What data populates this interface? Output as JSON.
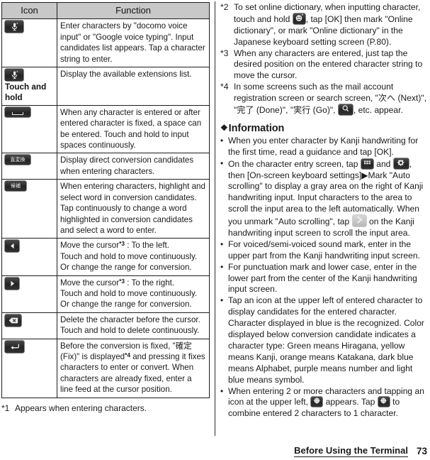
{
  "table": {
    "headers": [
      "Icon",
      "Function"
    ],
    "rows": [
      {
        "icon": "microphone-icon",
        "icon_label": "",
        "function": "Enter characters by \"docomo voice input\" or \"Google voice typing\". Input candidates list appears. Tap a character string to enter."
      },
      {
        "icon": "microphone-icon",
        "icon_label": "Touch and hold",
        "function": "Display the available extensions list."
      },
      {
        "icon": "space-key-icon",
        "icon_label": "",
        "function": "When any character is entered or after entered character is fixed, a space can be entered. Touch and hold to input spaces continuously."
      },
      {
        "icon": "direct-conversion-key-icon",
        "icon_glyph": "直変換",
        "icon_label": "",
        "function": "Display direct conversion candidates when entering characters."
      },
      {
        "icon": "candidates-key-icon",
        "icon_glyph": "候補",
        "icon_label": "",
        "function": "When entering characters, highlight and select word in conversion candidates. Tap continuously to change a word highlighted in conversion candidates and select a word to enter."
      },
      {
        "icon": "arrow-left-key-icon",
        "icon_label": "",
        "function_pre": "Move the cursor",
        "function_ref": "*3",
        "function_post": " : To the left.",
        "function_lines": [
          "Touch and hold to move continuously.",
          "Or change the range for conversion."
        ]
      },
      {
        "icon": "arrow-right-key-icon",
        "icon_label": "",
        "function_pre": "Move the cursor",
        "function_ref": "*3",
        "function_post": " : To the right.",
        "function_lines": [
          "Touch and hold to move continuously.",
          "Or change the range for conversion."
        ]
      },
      {
        "icon": "backspace-key-icon",
        "icon_label": "",
        "function": "Delete the character before the cursor. Touch and hold to delete continuously."
      },
      {
        "icon": "enter-key-icon",
        "icon_label": "",
        "function_pre": "Before the conversion is fixed, \"確定 (Fix)\" is displayed",
        "function_ref": "*4",
        "function_post": " and pressing it fixes characters to enter or convert. When characters are already fixed, enter a line feed at the cursor position."
      }
    ]
  },
  "left_footnotes": [
    {
      "mark": "*1",
      "text": "Appears when entering characters."
    }
  ],
  "right_footnotes": [
    {
      "mark": "*2",
      "part1": "To set online dictionary, when inputting character, touch and hold ",
      "icon": "emoji-key-icon",
      "part2": ", tap [OK] then mark \"Online dictionary\", or mark \"Online dictionary\" in the Japanese keyboard setting screen (P.80)."
    },
    {
      "mark": "*3",
      "part1": "When any characters are entered, just tap the desired position on the entered character string to move the cursor.",
      "icon": "",
      "part2": ""
    },
    {
      "mark": "*4",
      "part1": "In some screens such as the mail account registration screen or search screen, \"次へ (Next)\", \"完了 (Done)\", \"実行 (Go)\", ",
      "icon": "search-key-icon",
      "part2": ", etc. appear."
    }
  ],
  "information": {
    "heading": "Information",
    "diamond": "❖",
    "bullets": [
      {
        "segments": [
          {
            "type": "text",
            "value": "When you enter character by Kanji handwriting for the first time, read a guidance and tap [OK]."
          }
        ]
      },
      {
        "segments": [
          {
            "type": "text",
            "value": "On the character entry screen, tap "
          },
          {
            "type": "icon",
            "value": "grid-key-icon"
          },
          {
            "type": "text",
            "value": " and "
          },
          {
            "type": "icon",
            "value": "settings-key-icon"
          },
          {
            "type": "text",
            "value": ", then [On-screen keyboard settings]▶Mark \"Auto scrolling\" to display a gray area on the right of Kanji handwriting input. Input characters to the area to scroll the input area to the left automatically. When you unmark \"Auto scrolling\", tap "
          },
          {
            "type": "icon",
            "value": "scroll-right-icon"
          },
          {
            "type": "text",
            "value": " on the Kanji handwriting input screen to scroll the input area."
          }
        ]
      },
      {
        "segments": [
          {
            "type": "text",
            "value": "For voiced/semi-voiced sound mark, enter in the upper part from the Kanji handwriting input screen."
          }
        ]
      },
      {
        "segments": [
          {
            "type": "text",
            "value": "For punctuation mark and lower case, enter in the lower part from the center of the Kanji handwriting input screen."
          }
        ]
      },
      {
        "segments": [
          {
            "type": "text",
            "value": "Tap an icon at the upper left of entered character to display candidates for the entered character. Character displayed in blue is the recognized. Color displayed below conversion candidate indicates a character type: Green means Hiragana, yellow means Kanji, orange means Katakana, dark blue means Alphabet, purple means number and light blue means symbol."
          }
        ]
      },
      {
        "segments": [
          {
            "type": "text",
            "value": "When entering 2 or more characters and tapping an icon at the upper left, "
          },
          {
            "type": "icon",
            "value": "combine-key-icon"
          },
          {
            "type": "text",
            "value": " appears. Tap "
          },
          {
            "type": "icon",
            "value": "combine-key-icon"
          },
          {
            "type": "text",
            "value": " to combine entered 2 characters to 1 character."
          }
        ]
      }
    ]
  },
  "footer": {
    "section": "Before Using the Terminal",
    "page": "73"
  },
  "colors": {
    "header_bg": "#c8c8c8",
    "border": "#1d1d1d",
    "text": "#1a1a1a",
    "key_dark": "#2b2b2b"
  }
}
